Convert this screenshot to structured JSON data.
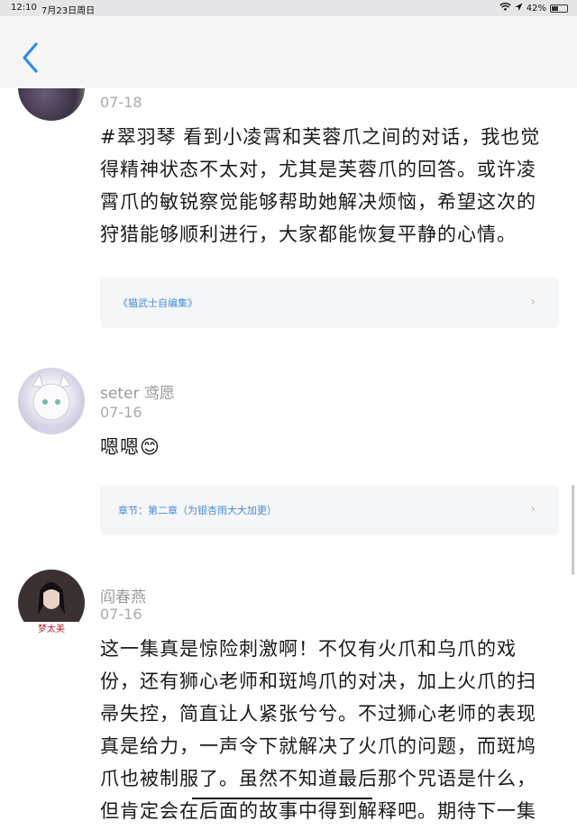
{
  "status": {
    "time": "12:10",
    "date": "7月23日周日",
    "battery": "42%",
    "battery_level": 0.42
  },
  "comments": [
    {
      "date": "07-18",
      "text": "#翠羽琴 看到小凌霄和芙蓉爪之间的对话，我也觉得精神状态不太对，尤其是芙蓉爪的回答。或许凌霄爪的敏锐察觉能够帮助她解决烦恼，希望这次的狩猎能够顺利进行，大家都能恢复平静的心情。",
      "ref": "《猫武士自编集》"
    },
    {
      "name": "seter 鸢愿",
      "date": "07-16",
      "text": "嗯嗯😊",
      "ref": "章节：第二章（为银杏雨大大加更）"
    },
    {
      "name": "阎春燕",
      "date": "07-16",
      "avatar_caption": "梦太美",
      "text": "这一集真是惊险刺激啊！不仅有火爪和乌爪的戏份，还有狮心老师和斑鸠爪的对决，加上火爪的扫帚失控，简直让人紧张兮兮。不过狮心老师的表现真是给力，一声令下就解决了火爪的问题，而斑鸠爪也被制服了。虽然不知道最后那个咒语是什么，但肯定会在后面的故事中得到解释吧。期待下一集的发"
    }
  ],
  "colors": {
    "accent": "#2f8ae8",
    "link": "#4a8cd6"
  }
}
